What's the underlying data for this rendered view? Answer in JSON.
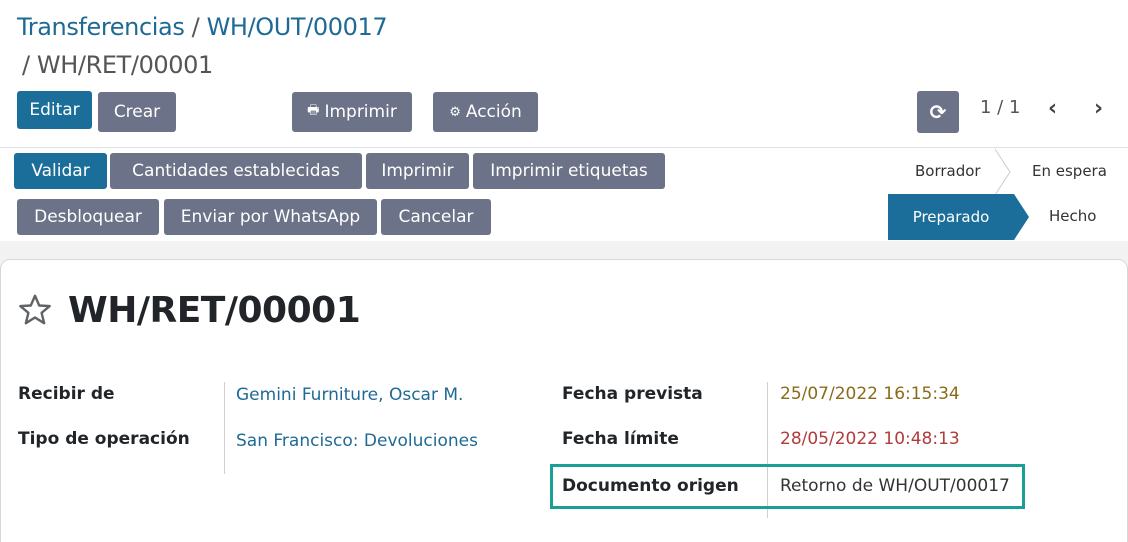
{
  "breadcrumb": {
    "root": "Transferencias",
    "sep1": "/",
    "parent": "WH/OUT/00017",
    "current": "/ WH/RET/00001"
  },
  "control": {
    "edit_label": "Editar",
    "create_label": "Crear",
    "print_label": "Imprimir",
    "action_label": "Acción",
    "pager": "1 / 1"
  },
  "actions": {
    "validate": "Validar",
    "set_quantities": "Cantidades establecidas",
    "print": "Imprimir",
    "print_labels": "Imprimir etiquetas",
    "unlock": "Desbloquear",
    "whatsapp": "Enviar por WhatsApp",
    "cancel": "Cancelar"
  },
  "statusbar": {
    "draft": "Borrador",
    "waiting": "En espera",
    "ready": "Preparado",
    "done": "Hecho",
    "active": "Preparado"
  },
  "record": {
    "name": "WH/RET/00001",
    "receive_from_label": "Recibir de",
    "receive_from": "Gemini Furniture, Oscar M.",
    "operation_type_label": "Tipo de operación",
    "operation_type": "San Francisco: Devoluciones",
    "scheduled_date_label": "Fecha prevista",
    "scheduled_date": "25/07/2022 16:15:34",
    "deadline_label": "Fecha límite",
    "deadline": "28/05/2022 10:48:13",
    "origin_label": "Documento origen",
    "origin": "Retorno de WH/OUT/00017"
  },
  "colors": {
    "primary": "#1b6e99",
    "secondary": "#6c7287",
    "highlight": "#1a9e95"
  }
}
